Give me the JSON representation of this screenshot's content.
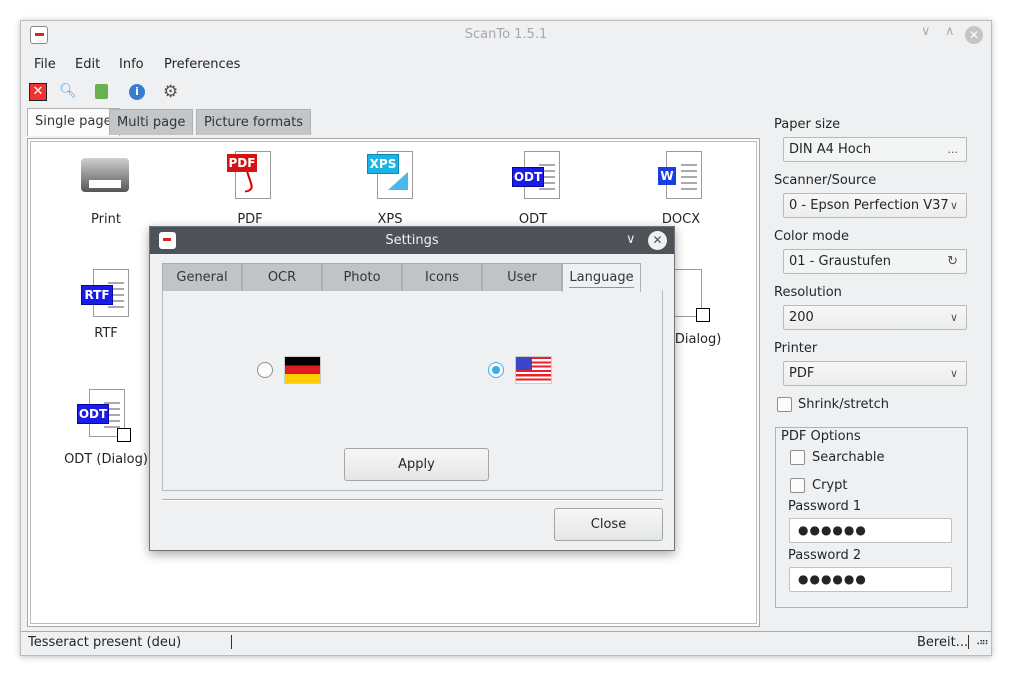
{
  "window": {
    "title": "ScanTo 1.5.1"
  },
  "menu": [
    "File",
    "Edit",
    "Info",
    "Preferences"
  ],
  "toolbar": [
    "close-icon",
    "search-icon",
    "book-icon",
    "info-icon",
    "gear-icon"
  ],
  "main_tabs": [
    {
      "label": "Single page",
      "active": true
    },
    {
      "label": "Multi page"
    },
    {
      "label": "Picture formats"
    }
  ],
  "items": {
    "print": "Print",
    "pdf": "PDF",
    "xps": "XPS",
    "odt": "ODT",
    "docx": "DOCX",
    "rtf": "RTF",
    "xps_dialog": "XPS (Dialog)",
    "odt_dialog": "ODT (Dialog)"
  },
  "badges": {
    "pdf": "PDF",
    "xps": "XPS",
    "odt": "ODT",
    "docx": "W",
    "rtf": "RTF"
  },
  "right": {
    "paper_size_label": "Paper size",
    "paper_size": "DIN A4 Hoch",
    "paper_more": "...",
    "scanner_label": "Scanner/Source",
    "scanner": "0 - Epson Perfection V37",
    "color_label": "Color mode",
    "color": "01 - Graustufen",
    "resolution_label": "Resolution",
    "resolution": "200",
    "printer_label": "Printer",
    "printer": "PDF",
    "shrink": "Shrink/stretch",
    "pdf_options": "PDF Options",
    "searchable": "Searchable",
    "crypt": "Crypt",
    "password1_label": "Password 1",
    "password1": "●●●●●●",
    "password2_label": "Password 2",
    "password2": "●●●●●●"
  },
  "status": {
    "left": "Tesseract present (deu)",
    "right": "Bereit..."
  },
  "dialog": {
    "title": "Settings",
    "tabs": [
      "General",
      "OCR",
      "Photo",
      "Icons",
      "User",
      "Language"
    ],
    "active_tab": "Language",
    "languages": [
      {
        "flag": "de",
        "selected": false
      },
      {
        "flag": "us",
        "selected": true
      }
    ],
    "apply": "Apply",
    "close": "Close"
  },
  "colors": {
    "accent": "#3daee9",
    "titlebar": "#4d5358"
  }
}
